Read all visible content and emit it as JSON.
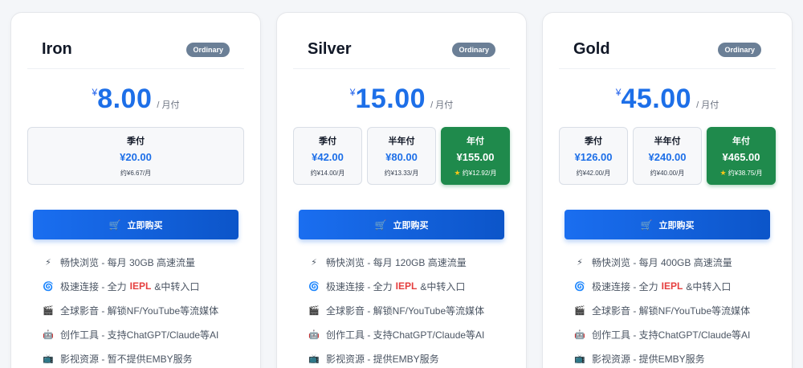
{
  "currency_symbol": "¥",
  "per_month_label": "/ 月付",
  "buy_label": "立即购买",
  "cards": [
    {
      "name": "Iron",
      "badge": "Ordinary",
      "monthly_price": "8.00",
      "options": [
        {
          "label": "季付",
          "price": "¥20.00",
          "note": "约¥6.67/月",
          "selected": false
        }
      ],
      "features": [
        {
          "icon": "lightning-icon",
          "text": "畅快浏览 - 每月 30GB 高速流量"
        },
        {
          "icon": "swirl-icon",
          "text_before": "极速连接 - 全力",
          "highlight": "IEPL",
          "text_after": "&中转入口"
        },
        {
          "icon": "clapper-icon",
          "text": "全球影音 - 解锁NF/YouTube等流媒体"
        },
        {
          "icon": "robot-icon",
          "text": "创作工具 - 支持ChatGPT/Claude等AI"
        },
        {
          "icon": "tv-icon",
          "text": "影视资源 - 暂不提供EMBY服务"
        }
      ]
    },
    {
      "name": "Silver",
      "badge": "Ordinary",
      "monthly_price": "15.00",
      "options": [
        {
          "label": "季付",
          "price": "¥42.00",
          "note": "约¥14.00/月",
          "selected": false
        },
        {
          "label": "半年付",
          "price": "¥80.00",
          "note": "约¥13.33/月",
          "selected": false
        },
        {
          "label": "年付",
          "price": "¥155.00",
          "note": "约¥12.92/月",
          "selected": true
        }
      ],
      "features": [
        {
          "icon": "lightning-icon",
          "text": "畅快浏览 - 每月 120GB 高速流量"
        },
        {
          "icon": "swirl-icon",
          "text_before": "极速连接 - 全力",
          "highlight": "IEPL",
          "text_after": "&中转入口"
        },
        {
          "icon": "clapper-icon",
          "text": "全球影音 - 解锁NF/YouTube等流媒体"
        },
        {
          "icon": "robot-icon",
          "text": "创作工具 - 支持ChatGPT/Claude等AI"
        },
        {
          "icon": "tv-icon",
          "text": "影视资源 - 提供EMBY服务"
        }
      ]
    },
    {
      "name": "Gold",
      "badge": "Ordinary",
      "monthly_price": "45.00",
      "options": [
        {
          "label": "季付",
          "price": "¥126.00",
          "note": "约¥42.00/月",
          "selected": false
        },
        {
          "label": "半年付",
          "price": "¥240.00",
          "note": "约¥40.00/月",
          "selected": false
        },
        {
          "label": "年付",
          "price": "¥465.00",
          "note": "约¥38.75/月",
          "selected": true
        }
      ],
      "features": [
        {
          "icon": "lightning-icon",
          "text": "畅快浏览 - 每月 400GB 高速流量"
        },
        {
          "icon": "swirl-icon",
          "text_before": "极速连接 - 全力",
          "highlight": "IEPL",
          "text_after": "&中转入口"
        },
        {
          "icon": "clapper-icon",
          "text": "全球影音 - 解锁NF/YouTube等流媒体"
        },
        {
          "icon": "robot-icon",
          "text": "创作工具 - 支持ChatGPT/Claude等AI"
        },
        {
          "icon": "tv-icon",
          "text": "影视资源 - 提供EMBY服务"
        }
      ]
    }
  ],
  "colors": {
    "accent_blue": "#1d6fe8",
    "selected_green": "#1f8a4c",
    "badge_gray": "#6b7f96",
    "highlight_red": "#e53e3e",
    "star_gold": "#f5c518"
  }
}
